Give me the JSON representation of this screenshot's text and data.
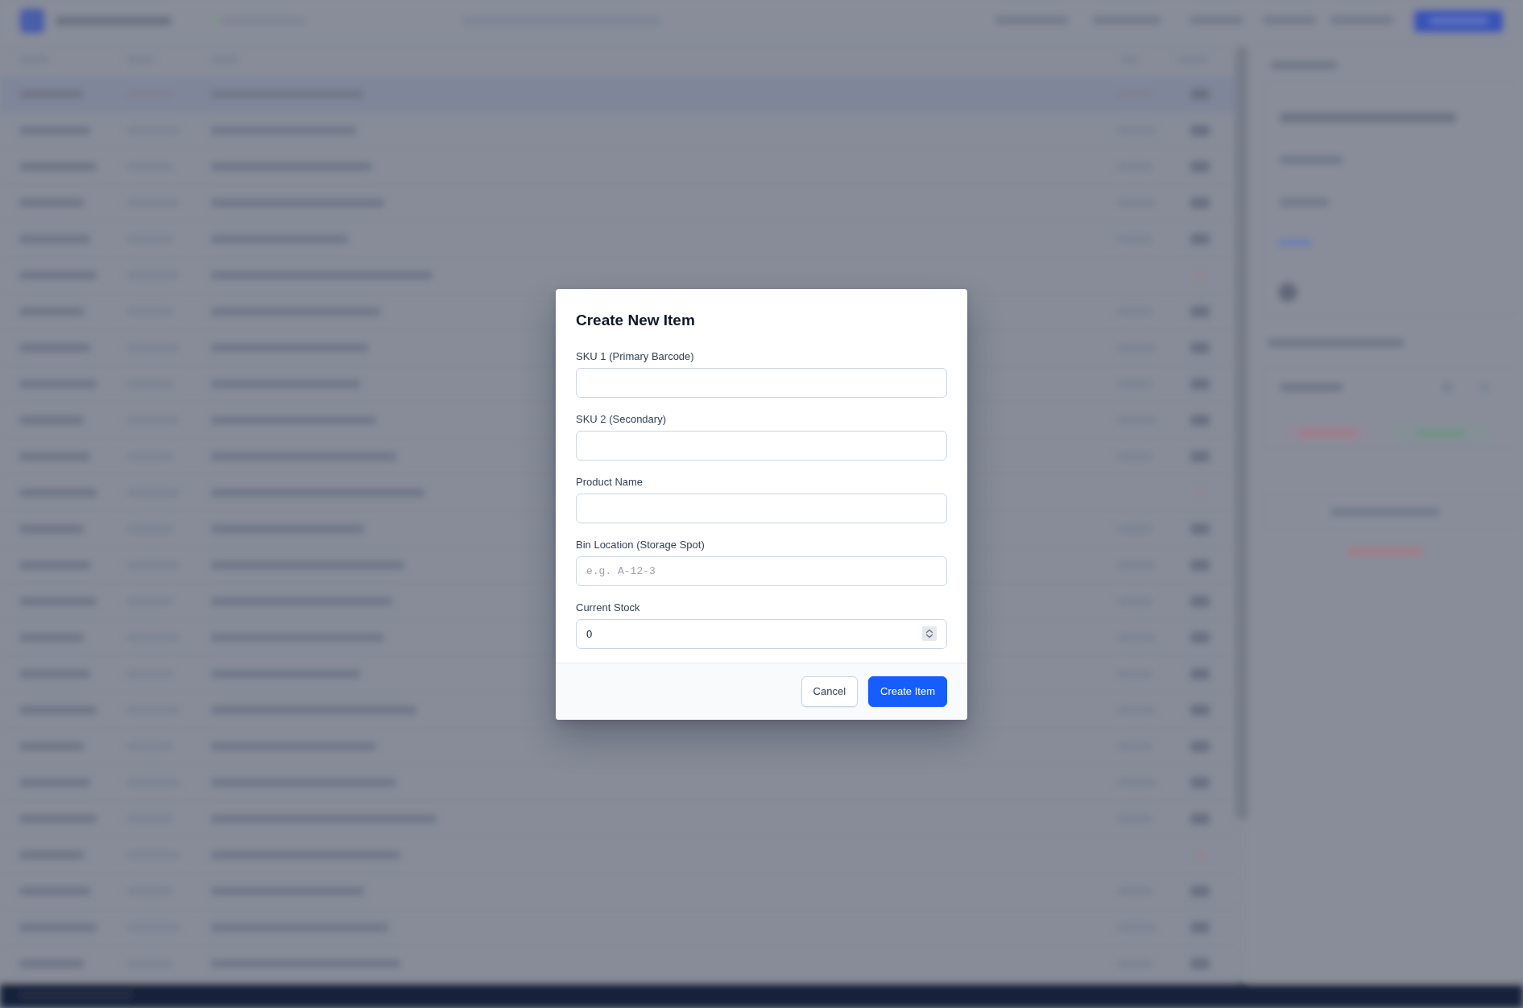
{
  "dialog": {
    "title": "Create New Item",
    "fields": [
      {
        "kind": "text",
        "label": "SKU 1 (Primary Barcode)"
      },
      {
        "kind": "text",
        "label": "SKU 2 (Secondary)"
      },
      {
        "kind": "text",
        "label": "Product Name"
      },
      {
        "kind": "code",
        "label": "Bin Location (Storage Spot)",
        "placeholder": "e.g. A-12-3"
      },
      {
        "kind": "number",
        "label": "Current Stock",
        "value": "0"
      }
    ],
    "buttons": [
      {
        "kind": "secondary",
        "label": "Cancel"
      },
      {
        "kind": "primary",
        "label": "Create Item"
      }
    ]
  }
}
